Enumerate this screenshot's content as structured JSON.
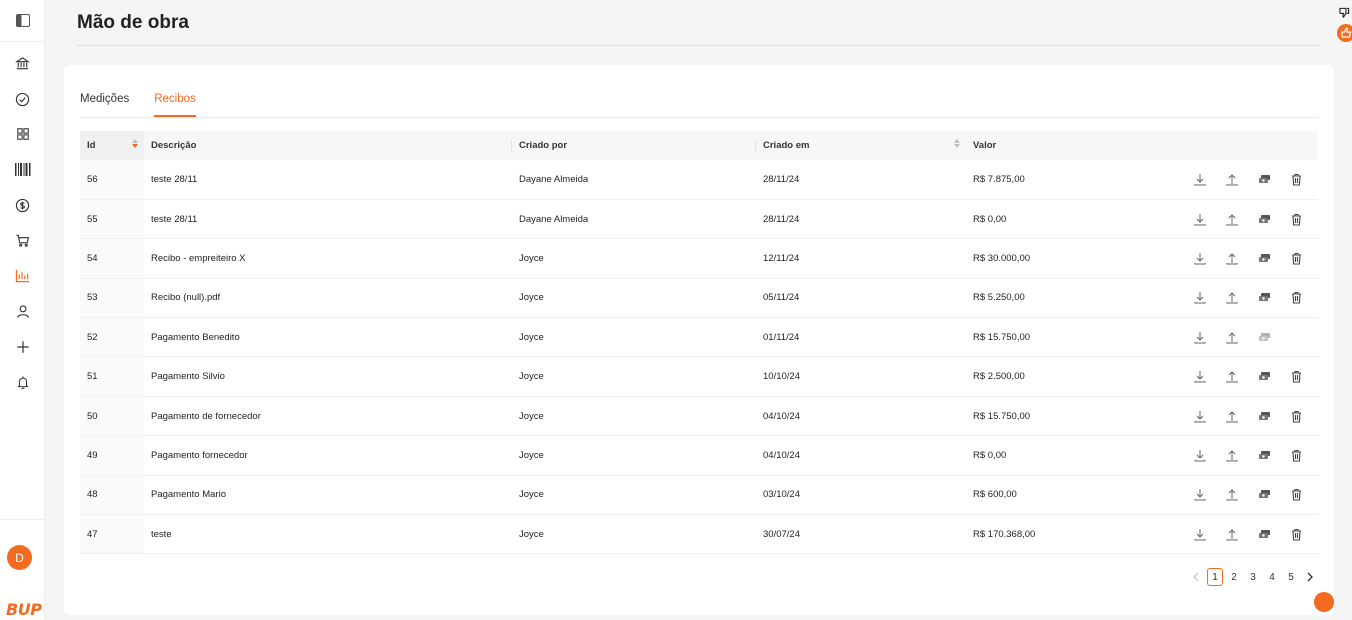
{
  "page": {
    "title": "Mão de obra"
  },
  "brand": {
    "logo_text": "BUP",
    "accent": "#f26b21"
  },
  "user": {
    "avatar_initial": "D"
  },
  "sidebar": {
    "items": [
      {
        "icon": "bank-icon"
      },
      {
        "icon": "check-circle-icon"
      },
      {
        "icon": "grid-icon"
      },
      {
        "icon": "barcode-icon"
      },
      {
        "icon": "dollar-circle-icon"
      },
      {
        "icon": "cart-icon"
      },
      {
        "icon": "bar-chart-icon",
        "active": true
      },
      {
        "icon": "user-icon"
      },
      {
        "icon": "plus-icon"
      },
      {
        "icon": "bell-icon"
      }
    ]
  },
  "tabs": [
    {
      "label": "Medições",
      "active": false
    },
    {
      "label": "Recibos",
      "active": true
    }
  ],
  "table": {
    "columns": {
      "id": "Id",
      "descricao": "Descrição",
      "criado_por": "Criado por",
      "criado_em": "Criado em",
      "valor": "Valor"
    },
    "rows": [
      {
        "id": "56",
        "descricao": "teste 28/11",
        "criado_por": "Dayane Almeida",
        "criado_em": "28/11/24",
        "valor": "R$ 7.875,00"
      },
      {
        "id": "55",
        "descricao": "teste 28/11",
        "criado_por": "Dayane Almeida",
        "criado_em": "28/11/24",
        "valor": "R$ 0,00"
      },
      {
        "id": "54",
        "descricao": "Recibo - empreiteiro X",
        "criado_por": "Joyce",
        "criado_em": "12/11/24",
        "valor": "R$ 30.000,00"
      },
      {
        "id": "53",
        "descricao": "Recibo (null).pdf",
        "criado_por": "Joyce",
        "criado_em": "05/11/24",
        "valor": "R$ 5.250,00"
      },
      {
        "id": "52",
        "descricao": "Pagamento Benedito",
        "criado_por": "Joyce",
        "criado_em": "01/11/24",
        "valor": "R$ 15.750,00"
      },
      {
        "id": "51",
        "descricao": "Pagamento Silvio",
        "criado_por": "Joyce",
        "criado_em": "10/10/24",
        "valor": "R$ 2.500,00"
      },
      {
        "id": "50",
        "descricao": "Pagamento de fornecedor",
        "criado_por": "Joyce",
        "criado_em": "04/10/24",
        "valor": "R$ 15.750,00"
      },
      {
        "id": "49",
        "descricao": "Pagamento fornecedor",
        "criado_por": "Joyce",
        "criado_em": "04/10/24",
        "valor": "R$ 0,00"
      },
      {
        "id": "48",
        "descricao": "Pagamento Mario",
        "criado_por": "Joyce",
        "criado_em": "03/10/24",
        "valor": "R$ 600,00"
      },
      {
        "id": "47",
        "descricao": "teste",
        "criado_por": "Joyce",
        "criado_em": "30/07/24",
        "valor": "R$ 170.368,00"
      }
    ]
  },
  "pagination": {
    "pages": [
      "1",
      "2",
      "3",
      "4",
      "5"
    ],
    "current": "1"
  }
}
